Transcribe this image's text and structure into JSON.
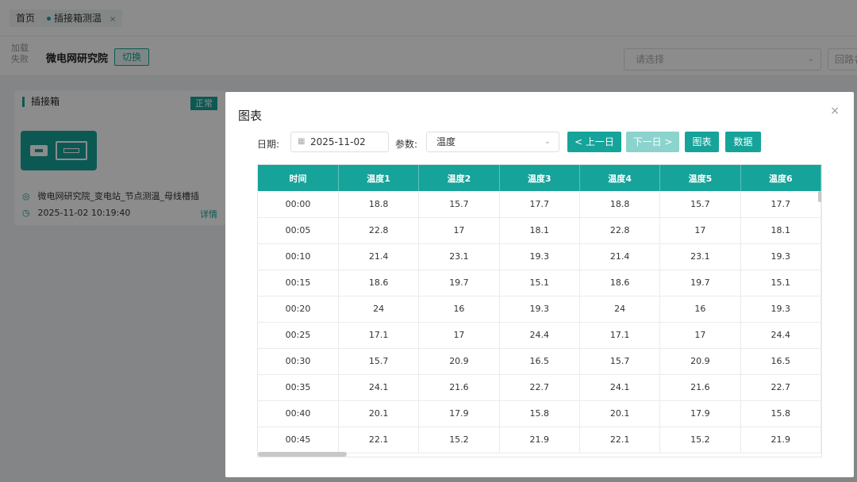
{
  "tabs": [
    {
      "label": "首页"
    },
    {
      "label": "插接箱测温",
      "close": "×"
    }
  ],
  "subbar": {
    "mini_lines": [
      "加载",
      "失败"
    ],
    "org_name": "微电网研究院",
    "switch_label": "切换",
    "select_placeholder": "请选择",
    "select2_text": "回路名"
  },
  "card": {
    "title": "插接箱",
    "status": "正常",
    "location": "微电网研究院_变电站_节点测温_母线槽插",
    "time": "2025-11-02 10:19:40",
    "detail": "详情"
  },
  "dialog": {
    "title": "图表",
    "close": "×",
    "date_label": "日期:",
    "date_value": "2025-11-02",
    "param_label": "参数:",
    "param_value": "温度",
    "prev_label": "< 上一日",
    "next_label": "下一日 >",
    "chart_label": "图表",
    "data_label": "数据"
  },
  "table": {
    "headers": [
      "时间",
      "温度1",
      "温度2",
      "温度3",
      "温度4",
      "温度5",
      "温度6"
    ],
    "rows": [
      [
        "00:00",
        "18.8",
        "15.7",
        "17.7",
        "18.8",
        "15.7",
        "17.7"
      ],
      [
        "00:05",
        "22.8",
        "17",
        "18.1",
        "22.8",
        "17",
        "18.1"
      ],
      [
        "00:10",
        "21.4",
        "23.1",
        "19.3",
        "21.4",
        "23.1",
        "19.3"
      ],
      [
        "00:15",
        "18.6",
        "19.7",
        "15.1",
        "18.6",
        "19.7",
        "15.1"
      ],
      [
        "00:20",
        "24",
        "16",
        "19.3",
        "24",
        "16",
        "19.3"
      ],
      [
        "00:25",
        "17.1",
        "17",
        "24.4",
        "17.1",
        "17",
        "24.4"
      ],
      [
        "00:30",
        "15.7",
        "20.9",
        "16.5",
        "15.7",
        "20.9",
        "16.5"
      ],
      [
        "00:35",
        "24.1",
        "21.6",
        "22.7",
        "24.1",
        "21.6",
        "22.7"
      ],
      [
        "00:40",
        "20.1",
        "17.9",
        "15.8",
        "20.1",
        "17.9",
        "15.8"
      ],
      [
        "00:45",
        "22.1",
        "15.2",
        "21.9",
        "22.1",
        "15.2",
        "21.9"
      ]
    ]
  },
  "colors": {
    "accent": "#16a39a",
    "accent_disabled": "#8cd3cd"
  }
}
